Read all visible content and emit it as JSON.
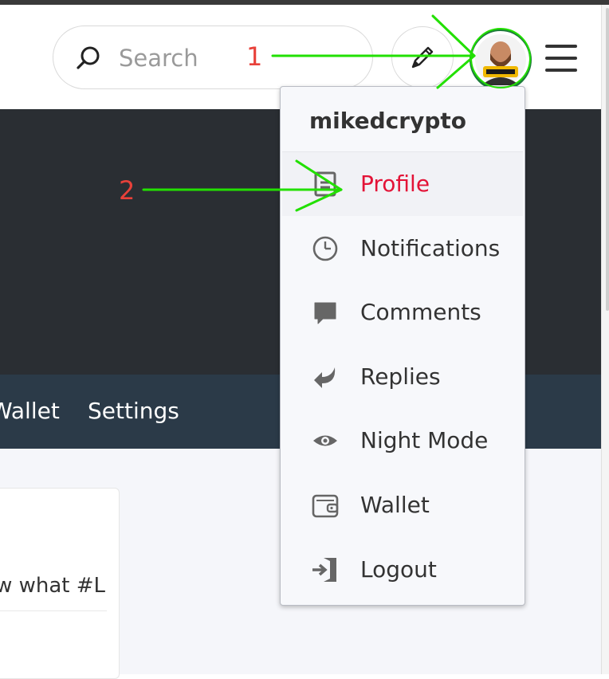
{
  "header": {
    "search_placeholder": "Search",
    "icons": [
      "search-icon",
      "pencil-icon",
      "avatar",
      "hamburger-icon"
    ]
  },
  "nav": {
    "items": [
      "Wallet",
      "Settings"
    ]
  },
  "card": {
    "snippet": "w what #L…"
  },
  "dropdown": {
    "username": "mikedcrypto",
    "items": [
      {
        "label": "Profile",
        "icon": "profile-icon",
        "active": true
      },
      {
        "label": "Notifications",
        "icon": "clock-icon"
      },
      {
        "label": "Comments",
        "icon": "comment-icon"
      },
      {
        "label": "Replies",
        "icon": "reply-icon"
      },
      {
        "label": "Night Mode",
        "icon": "eye-icon"
      },
      {
        "label": "Wallet",
        "icon": "wallet-icon"
      },
      {
        "label": "Logout",
        "icon": "logout-icon"
      }
    ]
  },
  "annotations": {
    "step1": "1",
    "step2": "2",
    "arrow_color": "#22e000",
    "number_color": "#e8413a"
  },
  "colors": {
    "accent": "#e31337",
    "hero_bg": "#2a2e33",
    "nav_bg": "#2b3a48",
    "avatar_ring": "#1d7b3a"
  }
}
